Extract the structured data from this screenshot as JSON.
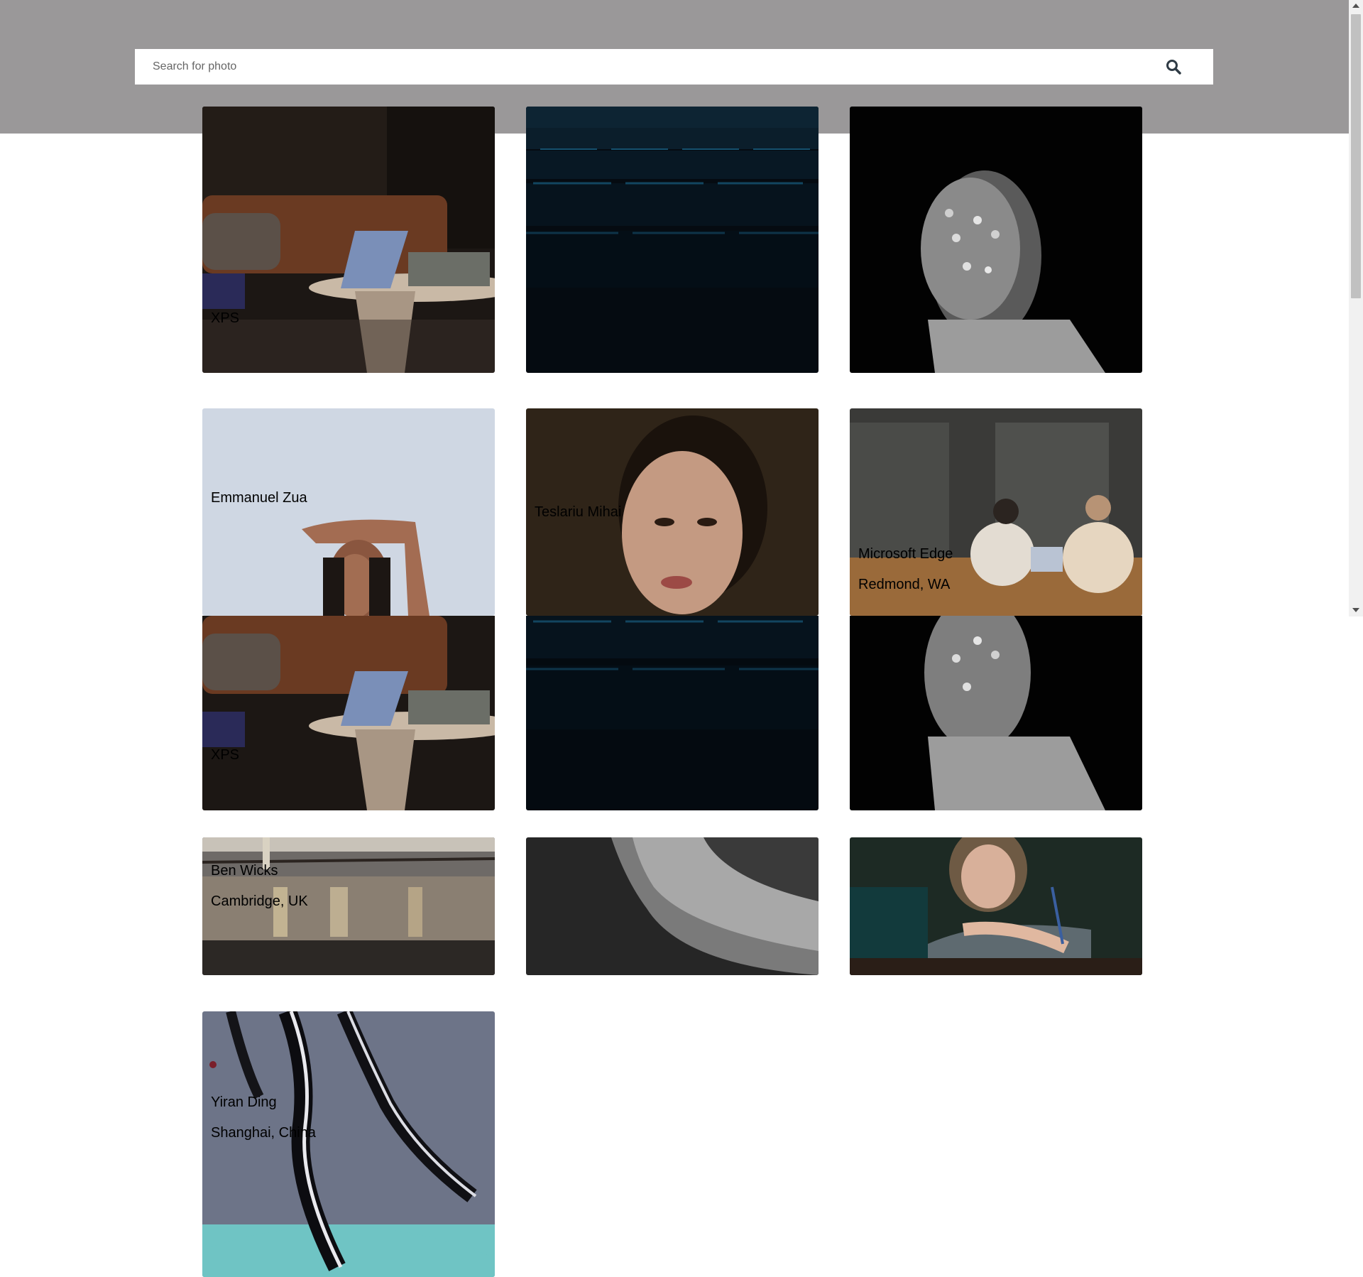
{
  "search": {
    "placeholder": "Search for photo",
    "icon": "search-icon"
  },
  "photos": [
    {
      "id": "laptop-livingroom",
      "subject": "laptop on side table in living room",
      "caption_1": "XPS",
      "caption_2": ""
    },
    {
      "id": "cinema-seats",
      "subject": "dark cinema seats",
      "caption_1": "",
      "caption_2": ""
    },
    {
      "id": "studded-face",
      "subject": "black and white portrait with studded face",
      "caption_1": "",
      "caption_2": ""
    },
    {
      "id": "woman-arm-raised",
      "subject": "woman with arm raised on light background",
      "caption_1": "Emmanuel Zua",
      "caption_2": ""
    },
    {
      "id": "woman-portrait-warm",
      "subject": "close portrait of woman",
      "caption_1": "Teslariu Mihai",
      "caption_2": ""
    },
    {
      "id": "cafe-meeting",
      "subject": "people meeting at cafe table with laptop",
      "caption_1": "Microsoft Edge",
      "caption_2": "Redmond, WA"
    },
    {
      "id": "laptop-livingroom-2",
      "subject": "laptop on side table in living room",
      "caption_1": "XPS",
      "caption_2": ""
    },
    {
      "id": "cinema-seats-2",
      "subject": "dark cinema seats",
      "caption_1": "",
      "caption_2": ""
    },
    {
      "id": "studded-face-2",
      "subject": "black and white portrait with studded face",
      "caption_1": "",
      "caption_2": ""
    },
    {
      "id": "city-bridge-night",
      "subject": "city bridge over water at night",
      "caption_1": "Ben Wicks",
      "caption_2": "Cambridge, UK"
    },
    {
      "id": "bw-profile",
      "subject": "black and white profile of a man",
      "caption_1": "",
      "caption_2": ""
    },
    {
      "id": "woman-with-pencil",
      "subject": "woman holding a pencil",
      "caption_1": "",
      "caption_2": ""
    },
    {
      "id": "aerial-river",
      "subject": "aerial view of river delta",
      "caption_1": "Yiran Ding",
      "caption_2": "Shanghai, China"
    }
  ],
  "colors": {
    "header_bg": "#9a9899",
    "page_bg": "#ffffff",
    "caption_text": "#000000"
  }
}
